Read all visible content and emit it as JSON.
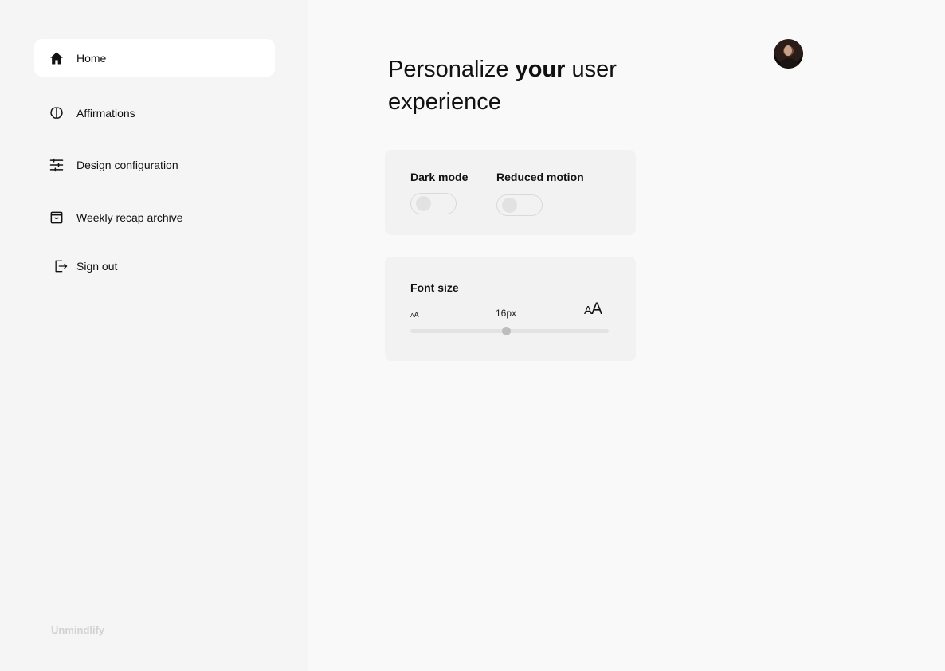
{
  "sidebar": {
    "items": [
      {
        "label": "Home",
        "icon": "home-icon",
        "active": true
      },
      {
        "label": "Affirmations",
        "icon": "brain-icon",
        "active": false
      },
      {
        "label": "Design configuration",
        "icon": "sliders-icon",
        "active": false
      },
      {
        "label": "Weekly recap archive",
        "icon": "archive-icon",
        "active": false
      },
      {
        "label": "Sign out",
        "icon": "sign-out-icon",
        "active": false
      }
    ],
    "brand": "Unmindlify"
  },
  "main": {
    "title_prefix": "Personalize ",
    "title_bold": "your",
    "title_suffix": " user experience",
    "toggles": [
      {
        "label": "Dark mode",
        "on": false
      },
      {
        "label": "Reduced motion",
        "on": false
      }
    ],
    "font_size": {
      "label": "Font size",
      "value_text": "16px",
      "small_glyph_a": "A",
      "small_glyph_b": "A",
      "big_glyph_a": "A",
      "big_glyph_b": "A",
      "level": 0.48
    }
  },
  "colors": {
    "sidebar_bg": "#f5f5f5",
    "main_bg": "#f9f9f9",
    "card_bg": "#f2f2f2",
    "active_item_bg": "#ffffff",
    "brand_text": "#d2d2d2"
  }
}
